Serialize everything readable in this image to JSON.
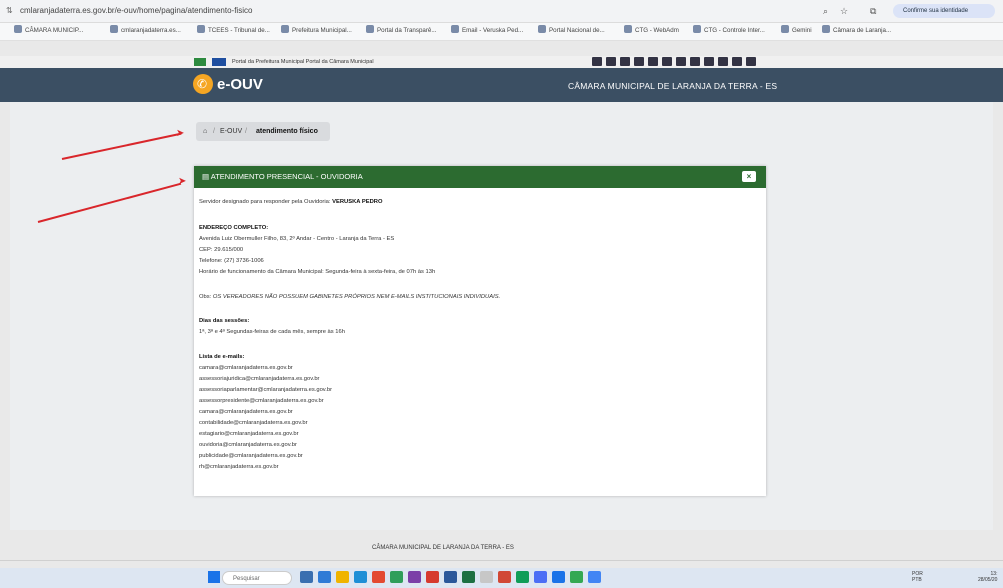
{
  "browser": {
    "url": "cmlaranjadaterra.es.gov.br/e-ouv/home/pagina/atendimento-fisico",
    "confirm_identity": "Confirme sua identidade",
    "bookmarks": [
      "CÂMARA MUNICIP...",
      "cmlaranjadaterra.es...",
      "TCEES - Tribunal de...",
      "Prefeitura Municipal...",
      "Portal da Transparê...",
      "Email - Veruska Ped...",
      "Portal Nacional de...",
      "CTG - WebAdm",
      "CTG - Controle Inter...",
      "Gemini",
      "Câmara de Laranja..."
    ]
  },
  "gov_bar": {
    "links": "Portal da Prefeitura Municipal    Portal da Câmara Municipal"
  },
  "header": {
    "logo": "e-OUV",
    "institution": "CÂMARA MUNICIPAL DE LARANJA DA TERRA - ES"
  },
  "breadcrumb": {
    "item1": "E-OUV",
    "item2": "atendimento físico"
  },
  "card": {
    "title": "ATENDIMENTO PRESENCIAL - OUVIDORIA",
    "server_label": "Servidor designado para responder pela Ouvidoria:",
    "server_name": "VERUSKA PEDRO",
    "address_heading": "ENDEREÇO COMPLETO:",
    "address_line": "Avenida Luiz Obermuller Filho, 83, 2º Andar - Centro - Laranja da Terra - ES",
    "cep": "CEP: 29.615/000",
    "phone": "Telefone: (27) 3736-1006",
    "hours": "Horário de funcionamento da Câmara Municipal: Segunda-feira à sexta-feira, de 07h às 13h",
    "obs_label": "Obs:",
    "obs_text": "OS VEREADORES NÃO POSSUEM GABINETES PRÓPRIOS NEM E-MAILS INSTITUCIONAIS INDIVIDUAIS.",
    "sessions_heading": "Dias das sessões:",
    "sessions_text": "1ª, 3ª e 4ª Segundas-feiras de cada mês, sempre às 16h",
    "emails_heading": "Lista de e-mails:",
    "emails": [
      "camara@cmlaranjadaterra.es.gov.br",
      "assessoriajuridica@cmlaranjadaterra.es.gov.br",
      "assessoriaparlamentar@cmlaranjadaterra.es.gov.br",
      "assessorpresidente@cmlaranjadaterra.es.gov.br",
      "camara@cmlaranjadaterra.es.gov.br",
      "contabilidade@cmlaranjadaterra.es.gov.br",
      "estagiario@cmlaranjadaterra.es.gov.br",
      "ouvidoria@cmlaranjadaterra.es.gov.br",
      "publicidade@cmlaranjadaterra.es.gov.br",
      "rh@cmlaranjadaterra.es.gov.br"
    ]
  },
  "footer": {
    "text": "CÂMARA MUNICIPAL DE LARANJA DA TERRA - ES"
  },
  "taskbar": {
    "search_placeholder": "Pesquisar",
    "lang": "POR",
    "lang2": "PTB",
    "time": "13:",
    "date": "28/05/20"
  },
  "colors": {
    "header_bg": "#3b4f63",
    "card_head_bg": "#2c6b30",
    "arrow": "#d9262b",
    "logo_accent": "#f5a623"
  }
}
